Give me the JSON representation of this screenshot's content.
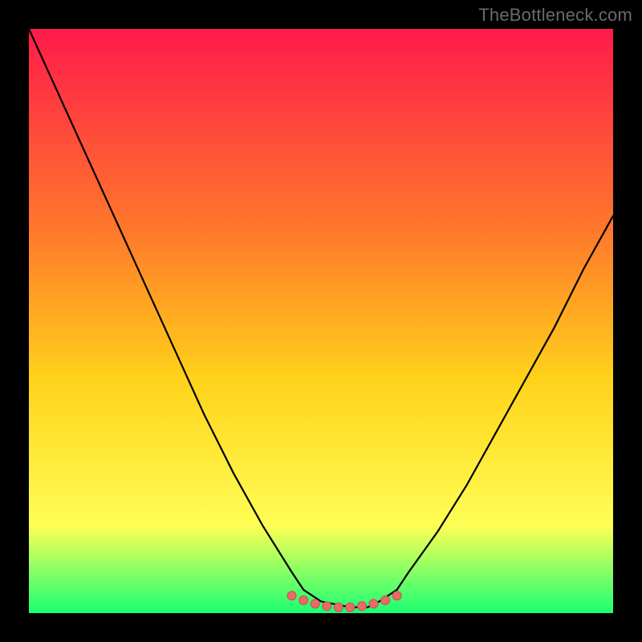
{
  "watermark": "TheBottleneck.com",
  "colors": {
    "frame": "#000000",
    "gradient_top": "#ff1a4a",
    "gradient_mid1": "#ff7a2a",
    "gradient_mid2": "#ffd21a",
    "gradient_mid3": "#ffff55",
    "gradient_bottom": "#1aff73",
    "curve": "#000000",
    "marker_fill": "#e86a6a",
    "marker_stroke": "#cc4f4f"
  },
  "chart_data": {
    "type": "line",
    "title": "",
    "xlabel": "",
    "ylabel": "",
    "xlim": [
      0,
      100
    ],
    "ylim": [
      0,
      100
    ],
    "series": [
      {
        "name": "bottleneck-curve",
        "x": [
          0,
          5,
          10,
          15,
          20,
          25,
          30,
          35,
          40,
          45,
          47,
          50,
          55,
          58,
          60,
          63,
          65,
          70,
          75,
          80,
          85,
          90,
          95,
          100
        ],
        "y": [
          100,
          89,
          78,
          67,
          56,
          45,
          34,
          24,
          15,
          7,
          4,
          2,
          1,
          1,
          2,
          4,
          7,
          14,
          22,
          31,
          40,
          49,
          59,
          68
        ]
      }
    ],
    "markers": {
      "name": "optimal-range",
      "x": [
        45,
        47,
        49,
        51,
        53,
        55,
        57,
        59,
        61,
        63
      ],
      "y": [
        3.0,
        2.2,
        1.6,
        1.2,
        1.0,
        1.0,
        1.2,
        1.6,
        2.2,
        3.0
      ]
    }
  }
}
